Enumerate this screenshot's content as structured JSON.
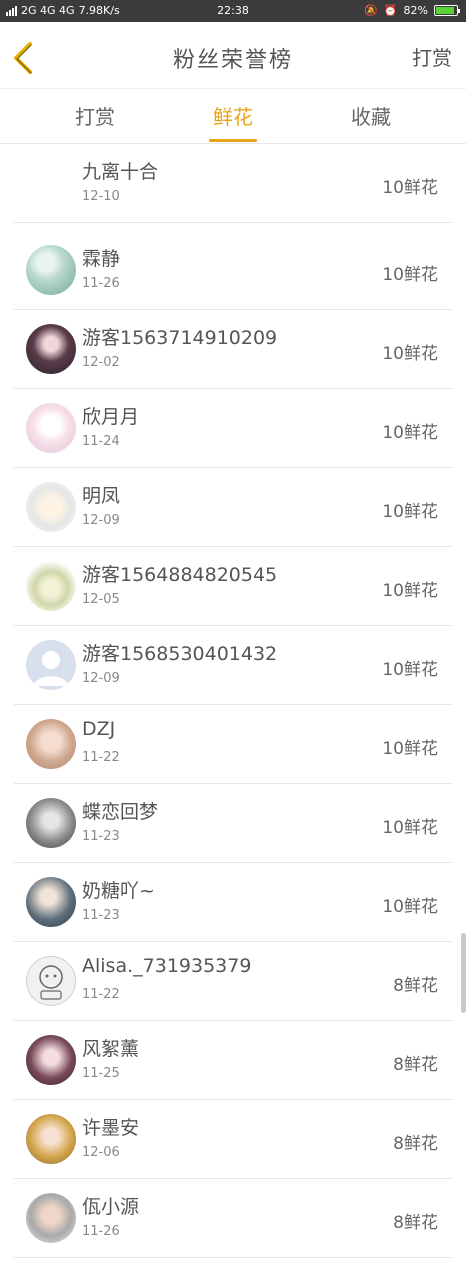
{
  "status": {
    "network": "2G 4G 4G",
    "speed": "7.98K/s",
    "time": "22:38",
    "battery": "82%"
  },
  "header": {
    "title": "粉丝荣誉榜",
    "action": "打赏"
  },
  "tabs": [
    {
      "label": "打赏",
      "active": false
    },
    {
      "label": "鲜花",
      "active": true
    },
    {
      "label": "收藏",
      "active": false
    }
  ],
  "items": [
    {
      "name": "九离十合",
      "date": "12-10",
      "amount": "10鲜花",
      "avatar": "none"
    },
    {
      "name": "霖静",
      "date": "11-26",
      "amount": "10鲜花",
      "avatar": "green"
    },
    {
      "name": "游客1563714910209",
      "date": "12-02",
      "amount": "10鲜花",
      "avatar": "dark"
    },
    {
      "name": "欣月月",
      "date": "11-24",
      "amount": "10鲜花",
      "avatar": "pink"
    },
    {
      "name": "明凤",
      "date": "12-09",
      "amount": "10鲜花",
      "avatar": "anime"
    },
    {
      "name": "游客1564884820545",
      "date": "12-05",
      "amount": "10鲜花",
      "avatar": "character"
    },
    {
      "name": "游客1568530401432",
      "date": "12-09",
      "amount": "10鲜花",
      "avatar": "default"
    },
    {
      "name": "DZJ",
      "date": "11-22",
      "amount": "10鲜花",
      "avatar": "photo-warm"
    },
    {
      "name": "蝶恋回梦",
      "date": "11-23",
      "amount": "10鲜花",
      "avatar": "photo-gray"
    },
    {
      "name": "奶糖吖~",
      "date": "11-23",
      "amount": "10鲜花",
      "avatar": "photo-blue"
    },
    {
      "name": "Alisa._731935379",
      "date": "11-22",
      "amount": "8鲜花",
      "avatar": "sketch"
    },
    {
      "name": "风絮薰",
      "date": "11-25",
      "amount": "8鲜花",
      "avatar": "photo-dark"
    },
    {
      "name": "许墨安",
      "date": "12-06",
      "amount": "8鲜花",
      "avatar": "photo-gold"
    },
    {
      "name": "佤小源",
      "date": "11-26",
      "amount": "8鲜花",
      "avatar": "photo-light"
    }
  ]
}
